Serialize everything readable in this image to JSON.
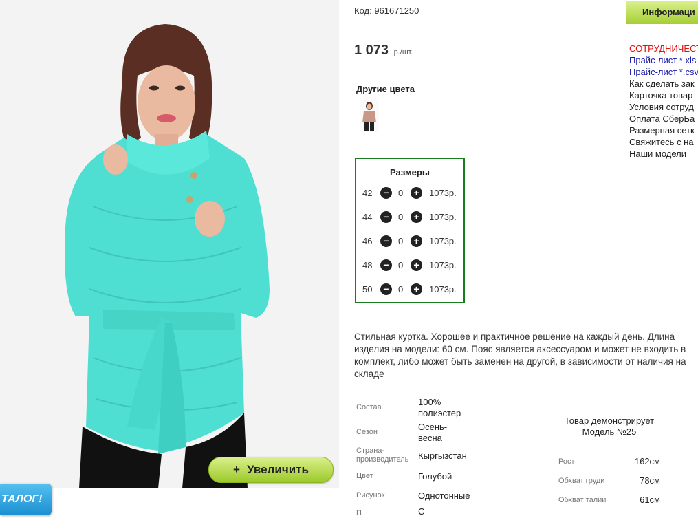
{
  "product": {
    "code": "Код: 961671250",
    "price": "1 073",
    "price_unit": "р./шт.",
    "other_colors_title": "Другие цвета",
    "zoom_button_label": "Увеличить",
    "zoom_button_icon": "+",
    "catalog_badge": "ТАЛОГ!"
  },
  "sizes": {
    "title": "Размеры",
    "rows": [
      {
        "size": "42",
        "qty": "0",
        "price": "1073р."
      },
      {
        "size": "44",
        "qty": "0",
        "price": "1073р."
      },
      {
        "size": "46",
        "qty": "0",
        "price": "1073р."
      },
      {
        "size": "48",
        "qty": "0",
        "price": "1073р."
      },
      {
        "size": "50",
        "qty": "0",
        "price": "1073р."
      }
    ]
  },
  "description": "Стильная куртка. Хорошее и практичное решение на каждый день. Длина изделия на модели: 60 см. Пояс является аксессуаром и может не входить в комплект, либо может быть заменен на другой, в зависимости от наличия на складе",
  "specs": [
    {
      "label": "Состав",
      "value": "100% полиэстер"
    },
    {
      "label": "Сезон",
      "value": "Осень-весна"
    },
    {
      "label": "Страна-производитель",
      "value": "Кыргызстан"
    },
    {
      "label": "Цвет",
      "value": "Голубой"
    },
    {
      "label": "Рисунок",
      "value": "Однотонные"
    },
    {
      "label": "П",
      "value": "С"
    }
  ],
  "model": {
    "title": "Товар демонстрирует Модель №25",
    "params": [
      {
        "label": "Рост",
        "value": "162см"
      },
      {
        "label": "Обхват груди",
        "value": "78см"
      },
      {
        "label": "Обхват талии",
        "value": "61см"
      }
    ]
  },
  "sidebar": {
    "info_button": "Информаци",
    "links": [
      {
        "text": "СОТРУДНИЧЕСТ",
        "style": "red"
      },
      {
        "text": "Прайс-лист *.xls",
        "style": "blue"
      },
      {
        "text": "Прайс-лист *.csv",
        "style": "blue"
      },
      {
        "text": "Как сделать зак",
        "style": "plain"
      },
      {
        "text": "Карточка товар",
        "style": "plain"
      },
      {
        "text": "Условия сотруд",
        "style": "plain"
      },
      {
        "text": "Оплата СберБа",
        "style": "plain"
      },
      {
        "text": "Размерная сетк",
        "style": "plain"
      },
      {
        "text": "Свяжитесь с на",
        "style": "plain"
      },
      {
        "text": "Наши модели",
        "style": "plain"
      }
    ]
  },
  "colors": {
    "jacket": "#4fdfd2",
    "accent_green": "#1e7a1e",
    "button_green": "#a6cf34",
    "link_red": "#e01010",
    "link_blue": "#1a1aa8"
  }
}
